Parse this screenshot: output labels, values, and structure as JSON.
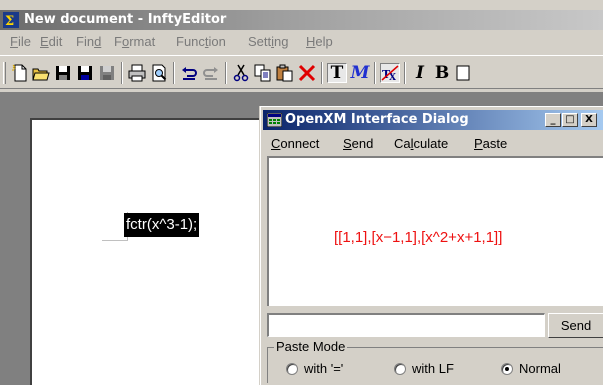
{
  "window": {
    "title": "New document - InftyEditor"
  },
  "menubar": {
    "items": [
      {
        "label": "File",
        "mnemonic": "F",
        "rest": "ile"
      },
      {
        "label": "Edit",
        "mnemonic": "E",
        "rest": "dit"
      },
      {
        "label": "Find",
        "pre": "Fin",
        "mnemonic": "d"
      },
      {
        "label": "Format",
        "pre": "F",
        "mnemonic": "o",
        "rest": "rmat"
      },
      {
        "label": "Function",
        "pre": "Func",
        "mnemonic": "t",
        "rest": "ion"
      },
      {
        "label": "Setting",
        "pre": "Sett",
        "mnemonic": "i",
        "rest": "ng"
      },
      {
        "label": "Help",
        "mnemonic": "H",
        "rest": "elp"
      }
    ]
  },
  "toolbar": {
    "text_buttons": {
      "text_mode": "T",
      "math_mode": "M",
      "italic": "I",
      "bold": "B"
    },
    "icons": [
      "new-document-icon",
      "open-folder-icon",
      "save-icon",
      "save-all-icon",
      "save-as-icon",
      "print-icon",
      "print-preview-icon",
      "undo-icon",
      "redo-icon",
      "cut-icon",
      "copy-icon",
      "paste-icon",
      "delete-icon",
      "text-mode-icon",
      "math-mode-icon",
      "tex-icon",
      "italic-icon",
      "bold-icon"
    ]
  },
  "document": {
    "selected_formula": "fctr(x^3-1);"
  },
  "dialog": {
    "title": "OpenXM Interface Dialog",
    "menu": [
      {
        "pre": "",
        "mnemonic": "C",
        "rest": "onnect"
      },
      {
        "pre": "",
        "mnemonic": "S",
        "rest": "end"
      },
      {
        "pre": "Ca",
        "mnemonic": "l",
        "rest": "culate"
      },
      {
        "pre": "",
        "mnemonic": "P",
        "rest": "aste"
      }
    ],
    "output": "[[1,1],[x−1,1],[x^2+x+1,1]]",
    "input_value": "",
    "send_label": "Send",
    "paste_mode": {
      "legend": "Paste Mode",
      "options": [
        "with '='",
        "with LF",
        "Normal"
      ],
      "selected": "Normal"
    },
    "controls": {
      "minimize": "_",
      "maximize": "□",
      "close": "X"
    }
  }
}
